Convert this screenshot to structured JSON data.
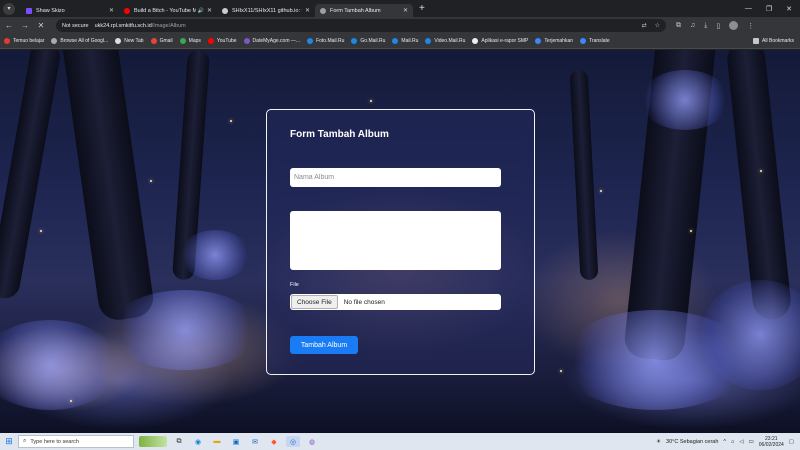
{
  "browser": {
    "tabs": [
      {
        "label": "Shaw Skizo",
        "color": "#7c4dff"
      },
      {
        "label": "Build a Bitch - YouTube Mu",
        "color": "#ff0000",
        "audio": "🔊"
      },
      {
        "label": "SHIxX11/SHIxX11 github.io: My",
        "color": "#cccccc"
      },
      {
        "label": "Form Tambah Album",
        "color": "#9aa0a6",
        "active": true
      }
    ],
    "new_tab": "+",
    "address": {
      "security": "Not secure",
      "host": "ukk24.rpl.smkitfu.sch.id",
      "path": "/Image/Album"
    },
    "bookmarks": [
      {
        "label": "Temuo belajar",
        "color": "#e53935"
      },
      {
        "label": "Browse All of Googl...",
        "color": "#aaaaaa"
      },
      {
        "label": "New Tab",
        "color": "#dddddd"
      },
      {
        "label": "Gmail",
        "color": "#ea4335"
      },
      {
        "label": "Maps",
        "color": "#34a853"
      },
      {
        "label": "YouTube",
        "color": "#ff0000"
      },
      {
        "label": "DateMyAge.com —...",
        "color": "#7e57c2"
      },
      {
        "label": "Foto.Mail.Ru",
        "color": "#1e88e5"
      },
      {
        "label": "Go.Mail.Ru",
        "color": "#1e88e5"
      },
      {
        "label": "Mail.Ru",
        "color": "#1e88e5"
      },
      {
        "label": "Video.Mail.Ru",
        "color": "#1e88e5"
      },
      {
        "label": "Aplikasi e-rapor SMP",
        "color": "#eeeeee"
      },
      {
        "label": "Terjemahkan",
        "color": "#4285f4"
      },
      {
        "label": "Translate",
        "color": "#4285f4"
      }
    ],
    "all_bookmarks": "All Bookmarks"
  },
  "form": {
    "title": "Form Tambah Album",
    "name_placeholder": "Nama Album",
    "description_placeholder": "",
    "file_label": "File",
    "file_button": "Choose File",
    "file_status": "No file chosen",
    "submit_label": "Tambah Album"
  },
  "taskbar": {
    "search_placeholder": "Type here to search",
    "weather": "30°C  Sebagian cerah",
    "time": "23:21",
    "date": "06/02/2024"
  },
  "colors": {
    "accent": "#1a7cf5",
    "card_border": "#f2f2f2"
  }
}
